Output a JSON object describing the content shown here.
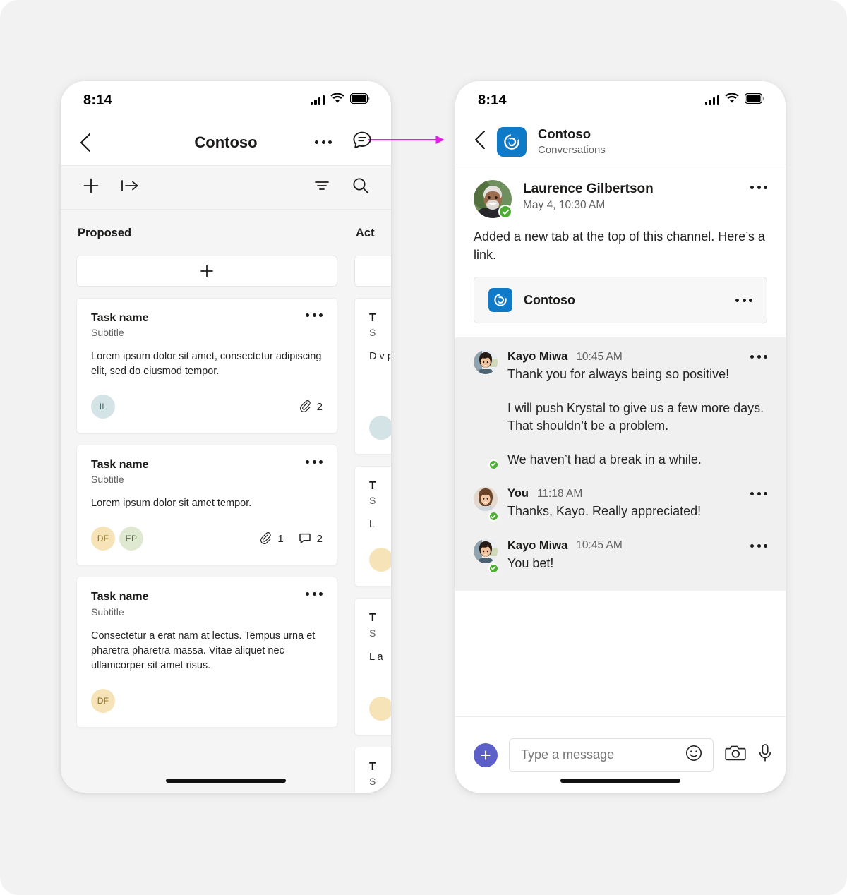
{
  "theme": {
    "page_bg": "#f2f2f2",
    "accent_blue": "#0f7ac8",
    "accent_purple": "#5b5fc7",
    "presence_green": "#4caf32",
    "arrow_color": "#e81ee8",
    "board_bg": "#f5f5f5",
    "thread_bg": "#f0f0f0"
  },
  "left_phone": {
    "status": {
      "time": "8:14",
      "signal_icon": "signal-bars-icon",
      "wifi_icon": "wifi-icon",
      "battery_icon": "battery-icon"
    },
    "nav": {
      "back_icon": "chevron-left-icon",
      "title": "Contoso",
      "more_icon": "more-horizontal-icon",
      "chat_icon": "chat-bubble-icon"
    },
    "toolbar": {
      "add_icon": "plus-icon",
      "move_icon": "move-to-icon",
      "filter_icon": "filter-icon",
      "search_icon": "search-icon"
    },
    "columns": [
      {
        "title": "Proposed",
        "add_card_icon": "plus-icon",
        "cards": [
          {
            "title": "Task name",
            "subtitle": "Subtitle",
            "body": "Lorem ipsum dolor sit amet, consectetur adipiscing elit, sed do eiusmod tempor.",
            "more_icon": "more-horizontal-icon",
            "avatars": [
              {
                "initials": "IL",
                "bg": "#d4e3e5",
                "fg": "#4a6b72"
              }
            ],
            "meta": [
              {
                "icon": "attachment-icon",
                "count": "2"
              }
            ]
          },
          {
            "title": "Task name",
            "subtitle": "Subtitle",
            "body": "Lorem ipsum dolor sit amet tempor.",
            "more_icon": "more-horizontal-icon",
            "avatars": [
              {
                "initials": "DF",
                "bg": "#f7e3b8",
                "fg": "#8a6d1f"
              },
              {
                "initials": "EP",
                "bg": "#dfe9d2",
                "fg": "#5b7242"
              }
            ],
            "meta": [
              {
                "icon": "attachment-icon",
                "count": "1"
              },
              {
                "icon": "comment-icon",
                "count": "2"
              }
            ]
          },
          {
            "title": "Task name",
            "subtitle": "Subtitle",
            "body": "Consectetur a erat nam at lectus. Tempus urna et pharetra pharetra massa. Vitae aliquet nec ullamcorper sit amet risus.",
            "more_icon": "more-horizontal-icon",
            "avatars": [
              {
                "initials": "DF",
                "bg": "#f7e3b8",
                "fg": "#8a6d1f"
              }
            ],
            "meta": []
          }
        ]
      },
      {
        "title": "Act",
        "add_card_icon": "plus-icon",
        "cards": [
          {
            "title": "T",
            "subtitle": "S",
            "body": "D v p p",
            "more_icon": "more-horizontal-icon",
            "avatars": [
              {
                "initials": "",
                "bg": "#d4e3e5",
                "fg": "#4a6b72"
              }
            ],
            "meta": []
          },
          {
            "title": "T",
            "subtitle": "S",
            "body": "L",
            "more_icon": "more-horizontal-icon",
            "avatars": [
              {
                "initials": "",
                "bg": "#f7e3b8",
                "fg": "#8a6d1f"
              }
            ],
            "meta": []
          },
          {
            "title": "T",
            "subtitle": "S",
            "body": "L a",
            "more_icon": "more-horizontal-icon",
            "avatars": [
              {
                "initials": "",
                "bg": "#f7e3b8",
                "fg": "#8a6d1f"
              }
            ],
            "meta": []
          },
          {
            "title": "T",
            "subtitle": "S",
            "body": "",
            "more_icon": "more-horizontal-icon",
            "avatars": [],
            "meta": []
          }
        ]
      }
    ]
  },
  "right_phone": {
    "status": {
      "time": "8:14",
      "signal_icon": "signal-bars-icon",
      "wifi_icon": "wifi-icon",
      "battery_icon": "battery-icon"
    },
    "header": {
      "back_icon": "chevron-left-icon",
      "app_logo_icon": "contoso-logo-icon",
      "title": "Contoso",
      "subtitle": "Conversations"
    },
    "root_message": {
      "avatar_icon": "avatar-laurence",
      "presence_icon": "available-check-icon",
      "sender": "Laurence Gilbertson",
      "timestamp": "May 4, 10:30 AM",
      "more_icon": "more-horizontal-icon",
      "body": "Added a new tab at the top of this channel. Here’s a link.",
      "link_card": {
        "logo_icon": "contoso-logo-icon",
        "label": "Contoso",
        "more_icon": "more-horizontal-icon"
      }
    },
    "replies": [
      {
        "avatar_icon": "avatar-kayo",
        "presence_icon": "available-check-icon",
        "sender": "Kayo Miwa",
        "timestamp": "10:45 AM",
        "more_icon": "more-horizontal-icon",
        "paragraphs": [
          "Thank you for always being so positive!",
          "I will push Krystal to give us a few more days. That shouldn’t be a problem.",
          "We haven’t had a break in a while."
        ]
      },
      {
        "avatar_icon": "avatar-you",
        "presence_icon": "available-check-icon",
        "sender": "You",
        "timestamp": "11:18 AM",
        "more_icon": "more-horizontal-icon",
        "paragraphs": [
          "Thanks, Kayo. Really appreciated!"
        ]
      },
      {
        "avatar_icon": "avatar-kayo",
        "presence_icon": "available-check-icon",
        "sender": "Kayo Miwa",
        "timestamp": "10:45 AM",
        "more_icon": "more-horizontal-icon",
        "paragraphs": [
          "You bet!"
        ]
      }
    ],
    "compose": {
      "plus_icon": "plus-circle-icon",
      "placeholder": "Type a message",
      "emoji_icon": "emoji-smiley-icon",
      "camera_icon": "camera-icon",
      "mic_icon": "microphone-icon"
    }
  },
  "annotation": {
    "arrow_icon": "flow-arrow-icon"
  }
}
